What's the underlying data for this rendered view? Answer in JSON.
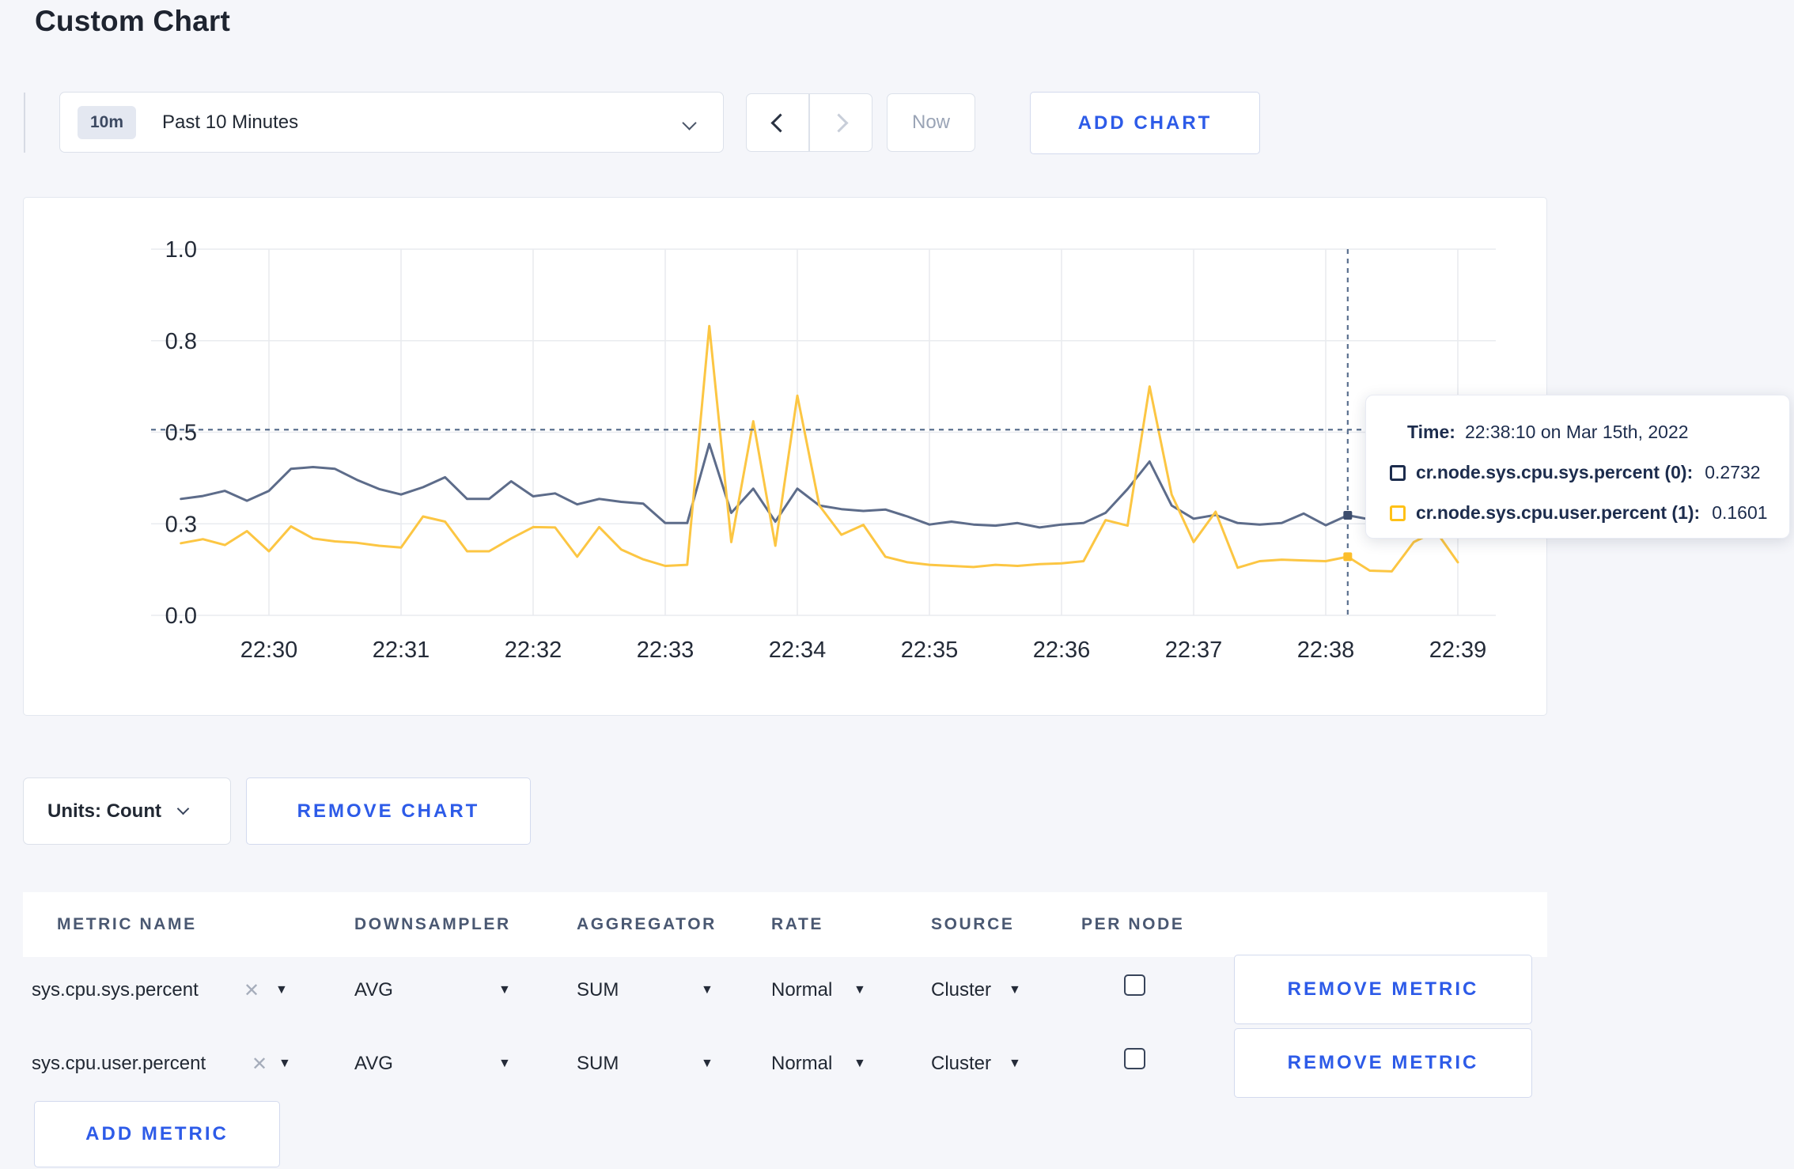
{
  "page": {
    "title": "Custom Chart",
    "background": "#f5f6fa",
    "accent_blue": "#2d5be8"
  },
  "toolbar": {
    "time_range_badge": "10m",
    "time_range_label": "Past 10 Minutes",
    "now_label": "Now",
    "add_chart_label": "ADD CHART"
  },
  "chart_data": {
    "type": "line",
    "title": "",
    "xlabel": "",
    "ylabel": "",
    "grid": true,
    "x_tick_labels": [
      "22:30",
      "22:31",
      "22:32",
      "22:33",
      "22:34",
      "22:35",
      "22:36",
      "22:37",
      "22:38",
      "22:39"
    ],
    "y_ticks": [
      {
        "value": 0.0,
        "label": "0.0"
      },
      {
        "value": 0.25,
        "label": "0.3"
      },
      {
        "value": 0.5,
        "label": "0.5"
      },
      {
        "value": 0.75,
        "label": "0.8"
      },
      {
        "value": 1.0,
        "label": "1.0"
      }
    ],
    "ylim": [
      0,
      1
    ],
    "start_time": "22:29:20",
    "interval_sec": 10,
    "start_offset_sec_from_first_tick": -40,
    "series": [
      {
        "name": "cr.node.sys.cpu.sys.percent",
        "color": "#5d6c8a",
        "marker_color": "#3d4d6d",
        "values": [
          0.318,
          0.326,
          0.34,
          0.313,
          0.34,
          0.4,
          0.405,
          0.4,
          0.37,
          0.345,
          0.33,
          0.35,
          0.377,
          0.318,
          0.318,
          0.366,
          0.325,
          0.333,
          0.303,
          0.318,
          0.31,
          0.305,
          0.252,
          0.252,
          0.468,
          0.28,
          0.346,
          0.256,
          0.346,
          0.3,
          0.29,
          0.285,
          0.289,
          0.27,
          0.248,
          0.256,
          0.248,
          0.245,
          0.252,
          0.24,
          0.248,
          0.252,
          0.28,
          0.345,
          0.42,
          0.3,
          0.264,
          0.274,
          0.252,
          0.248,
          0.252,
          0.278,
          0.246,
          0.2732,
          0.262,
          0.27,
          0.286,
          0.295,
          0.3
        ]
      },
      {
        "name": "cr.node.sys.cpu.user.percent",
        "color": "#fcc643",
        "marker_color": "#fcbe2b",
        "values": [
          0.197,
          0.208,
          0.192,
          0.23,
          0.175,
          0.243,
          0.21,
          0.202,
          0.198,
          0.19,
          0.185,
          0.27,
          0.256,
          0.175,
          0.175,
          0.21,
          0.241,
          0.24,
          0.16,
          0.241,
          0.18,
          0.153,
          0.135,
          0.138,
          0.79,
          0.2,
          0.53,
          0.19,
          0.6,
          0.3,
          0.22,
          0.247,
          0.16,
          0.145,
          0.138,
          0.135,
          0.132,
          0.138,
          0.135,
          0.14,
          0.142,
          0.148,
          0.26,
          0.245,
          0.625,
          0.33,
          0.2,
          0.283,
          0.13,
          0.148,
          0.152,
          0.15,
          0.148,
          0.1601,
          0.122,
          0.12,
          0.2,
          0.23,
          0.145
        ]
      }
    ],
    "crosshair": {
      "x_offset_sec_from_first_tick": 490,
      "hline_value": 0.507,
      "color": "#5b708f",
      "marker_values": [
        0.2732,
        0.1601
      ]
    },
    "legend_position": "tooltip"
  },
  "tooltip": {
    "time_label": "Time:",
    "time_value": "22:38:10 on Mar 15th, 2022",
    "entries": [
      {
        "name": "cr.node.sys.cpu.sys.percent (0):",
        "value": "0.2732",
        "swatch_color": "#1c2c4d"
      },
      {
        "name": "cr.node.sys.cpu.user.percent (1):",
        "value": "0.1601",
        "swatch_color": "#ffc117"
      }
    ]
  },
  "units_bar": {
    "units_label": "Units: Count",
    "remove_chart_label": "REMOVE CHART"
  },
  "icons": {
    "close_x": "✕",
    "caret_down": "▼"
  },
  "metrics_table": {
    "headers": [
      "METRIC NAME",
      "DOWNSAMPLER",
      "AGGREGATOR",
      "RATE",
      "SOURCE",
      "PER NODE"
    ],
    "rows": [
      {
        "name": "sys.cpu.sys.percent",
        "downsampler": "AVG",
        "aggregator": "SUM",
        "rate": "Normal",
        "source": "Cluster",
        "per_node_checked": false,
        "remove_label": "REMOVE METRIC"
      },
      {
        "name": "sys.cpu.user.percent",
        "downsampler": "AVG",
        "aggregator": "SUM",
        "rate": "Normal",
        "source": "Cluster",
        "per_node_checked": false,
        "remove_label": "REMOVE METRIC"
      }
    ],
    "add_metric_label": "ADD METRIC"
  }
}
